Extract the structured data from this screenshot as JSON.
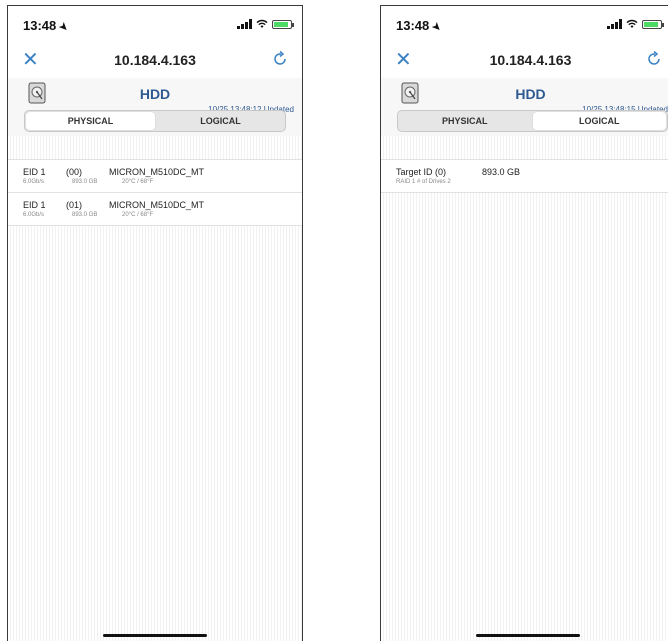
{
  "left": {
    "status": {
      "time": "13:48",
      "location_icon": "location-arrow-icon"
    },
    "nav": {
      "title": "10.184.4.163",
      "close_icon": "close-icon",
      "refresh_icon": "refresh-icon"
    },
    "header": {
      "title": "HDD",
      "updated": "10/25 13:48:12 Updated"
    },
    "tabs": [
      {
        "label": "PHYSICAL",
        "active": true
      },
      {
        "label": "LOGICAL",
        "active": false
      }
    ],
    "rows": [
      {
        "eid": "EID 1",
        "slot": "(00)",
        "model": "MICRON_M510DC_MT",
        "speed": "6.0Gb/s",
        "size": "893.0 GB",
        "temp": "20°C / 68°F"
      },
      {
        "eid": "EID 1",
        "slot": "(01)",
        "model": "MICRON_M510DC_MT",
        "speed": "6.0Gb/s",
        "size": "893.0 GB",
        "temp": "20°C / 68°F"
      }
    ]
  },
  "right": {
    "status": {
      "time": "13:48",
      "location_icon": "location-arrow-icon"
    },
    "nav": {
      "title": "10.184.4.163",
      "close_icon": "close-icon",
      "refresh_icon": "refresh-icon"
    },
    "header": {
      "title": "HDD",
      "updated": "10/25 13:48:15 Updated"
    },
    "tabs": [
      {
        "label": "PHYSICAL",
        "active": false
      },
      {
        "label": "LOGICAL",
        "active": true
      }
    ],
    "rows": [
      {
        "target": "Target ID (0)",
        "size": "893.0 GB",
        "detail": "RAID 1 # of Drives 2"
      }
    ]
  },
  "colors": {
    "accent": "#3b82c4",
    "header_text": "#2f5a91",
    "battery": "#4cd964"
  }
}
